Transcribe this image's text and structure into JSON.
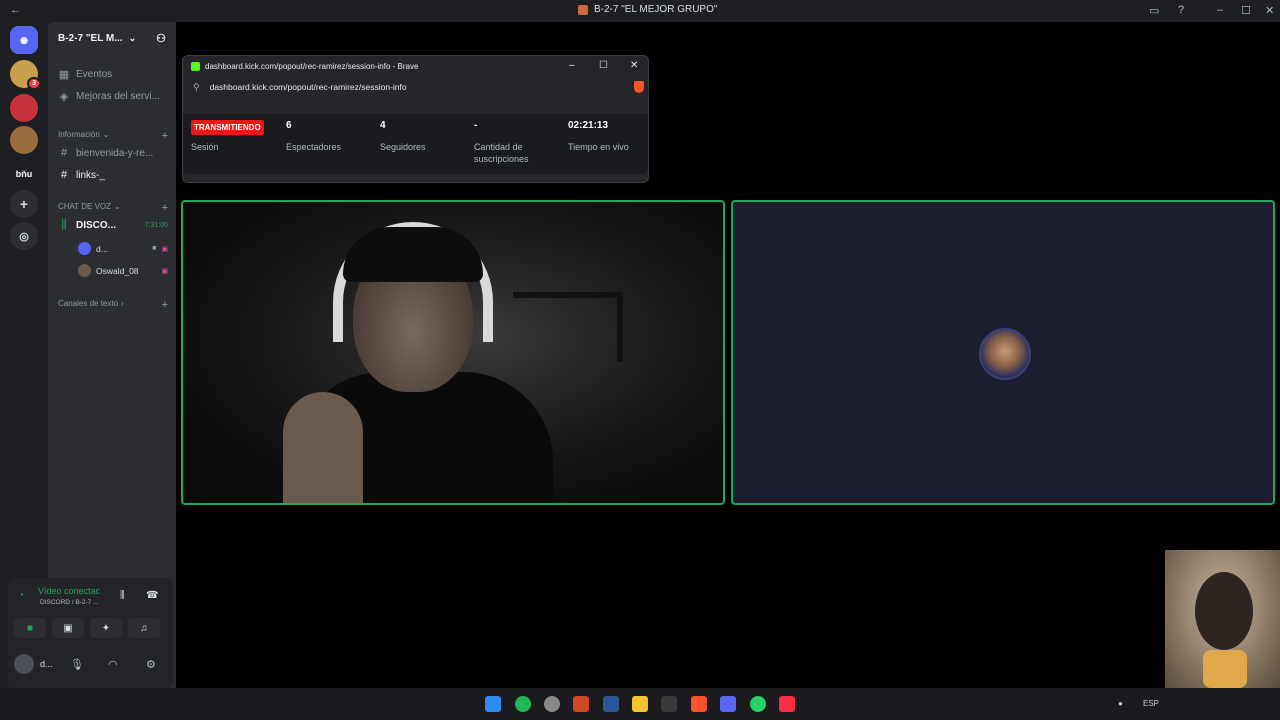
{
  "window": {
    "title": "B-2-7 \"EL MEJOR GRUPO\""
  },
  "titlebar_icons": {
    "back": "←",
    "inbox": "▭",
    "help": "?",
    "minimize": "–",
    "maximize": "☐",
    "close": "✕"
  },
  "servers": [
    {
      "label": "",
      "badge": "",
      "color": "#5865f2"
    },
    {
      "label": "",
      "badge": "3",
      "color": "#c9a14a"
    },
    {
      "label": "",
      "badge": "",
      "color": "#c8323a"
    },
    {
      "label": "",
      "badge": "",
      "color": "#9c6b3c"
    },
    {
      "label": "bňu",
      "badge": "",
      "color": "transparent"
    }
  ],
  "server": {
    "name": "B-2-7 \"EL M...",
    "menu": [
      {
        "icon": "calendar-icon",
        "glyph": "▦",
        "label": "Eventos"
      },
      {
        "icon": "boost-icon",
        "glyph": "◈",
        "label": "Mejoras del servi..."
      }
    ],
    "categories": {
      "info": "Información",
      "voice": "CHAT DE VOZ",
      "text": "Canales de texto"
    },
    "text_channels": [
      {
        "label": "bienvenida-y-re..."
      },
      {
        "label": "links-_"
      }
    ],
    "voice_channel": {
      "label": "DISCO...",
      "timer": "7:31:05",
      "users": [
        {
          "name": "d..."
        },
        {
          "name": "Oswald_08"
        }
      ]
    }
  },
  "voice_panel": {
    "status": "Vídeo conectac",
    "sub": "DISCORD / B-2-7 ...",
    "user": "d..."
  },
  "popout": {
    "title": "dashboard.kick.com/popout/rec-ramirez/session-info - Brave",
    "url": "dashboard.kick.com/popout/rec-ramirez/session-info",
    "live_label": "TRANSMITIENDO",
    "session_label": "Sesión",
    "stats": [
      {
        "value": "6",
        "label": "Espectadores"
      },
      {
        "value": "4",
        "label": "Seguidores"
      },
      {
        "value": "-",
        "label": "Cantidad de suscripciones"
      },
      {
        "value": "02:21:13",
        "label": "Tiempo en vivo"
      }
    ]
  },
  "taskbar": {
    "lang": "ESP",
    "apps": [
      "windows-icon",
      "spotify-icon",
      "chrome-icon",
      "powerpoint-icon",
      "word-icon",
      "files-icon",
      "capcut-icon",
      "brave-icon",
      "discord-icon",
      "whatsapp-icon",
      "music-icon"
    ]
  },
  "colors": {
    "accent_green": "#23a55a",
    "kick_green": "#53fc18",
    "live_red": "#e91916",
    "discord_bg": "#1e1f22"
  }
}
